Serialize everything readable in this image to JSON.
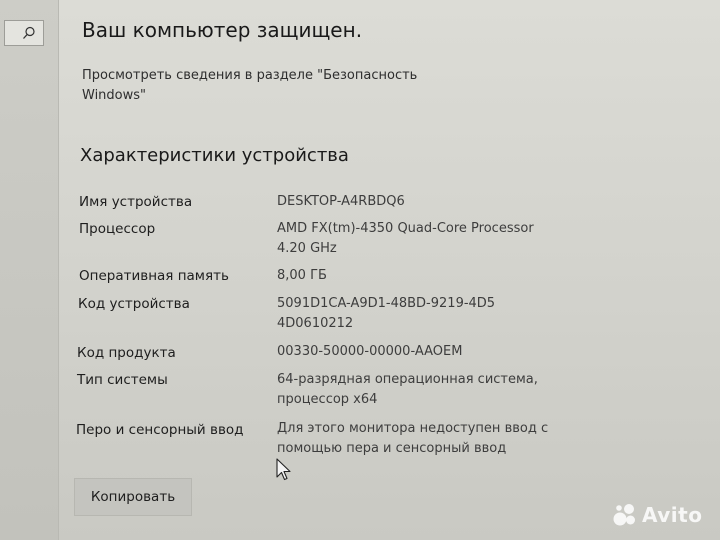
{
  "sidebar": {
    "search_icon": "search-icon"
  },
  "security": {
    "status": "Ваш компьютер защищен.",
    "link_text": "Просмотреть сведения в разделе \"Безопасность Windows\""
  },
  "device_specs": {
    "title": "Характеристики устройства",
    "rows": [
      {
        "label": "Имя устройства",
        "value": "DESKTOP-A4RBDQ6"
      },
      {
        "label": "Процессор",
        "value": "AMD FX(tm)-4350 Quad-Core Processor 4.20 GHz"
      },
      {
        "label": "Оперативная память",
        "value": "8,00 ГБ"
      },
      {
        "label": "Код устройства",
        "value": "5091D1CA-A9D1-48BD-9219-4D54D0610212"
      },
      {
        "label": "Код продукта",
        "value": "00330-50000-00000-AAOEM"
      },
      {
        "label": "Тип системы",
        "value": "64-разрядная операционная система, процессор x64"
      },
      {
        "label": "Перо и сенсорный ввод",
        "value": "Для этого монитора недоступен ввод с помощью пера и сенсорный ввод"
      }
    ],
    "copy_button": "Копировать"
  },
  "watermark": {
    "text": "Avito"
  }
}
